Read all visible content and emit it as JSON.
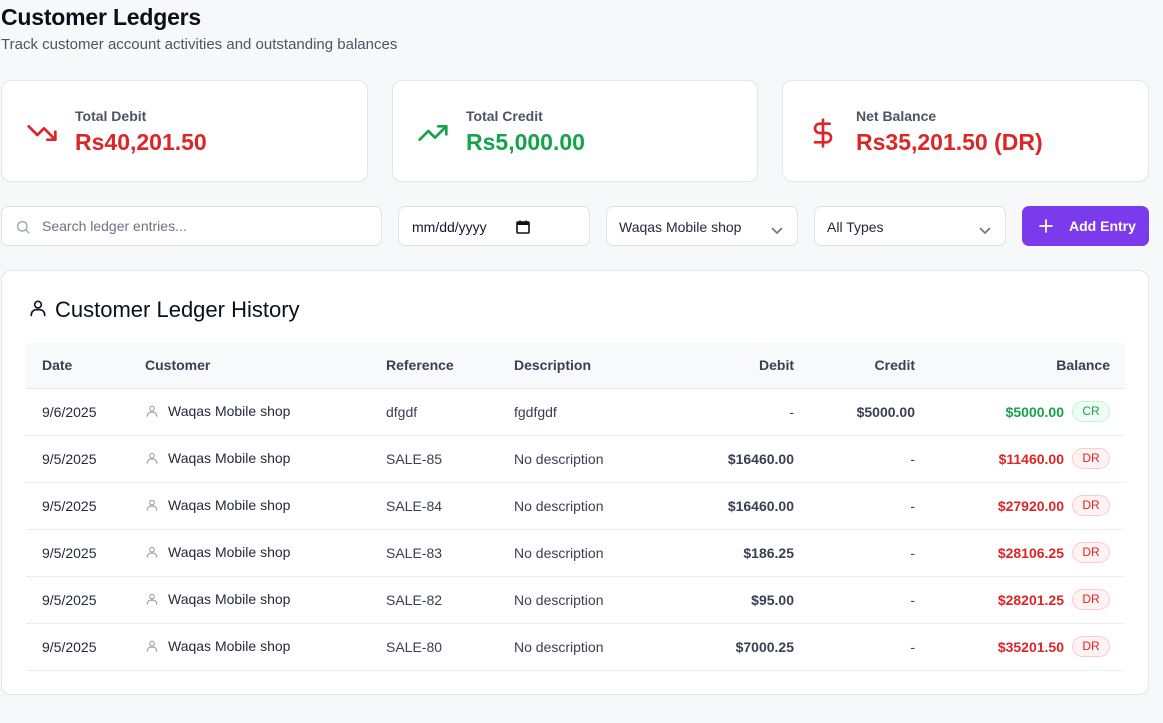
{
  "header": {
    "title": "Customer Ledgers",
    "subtitle": "Track customer account activities and outstanding balances"
  },
  "stats": {
    "debit": {
      "label": "Total Debit",
      "value": "Rs40,201.50",
      "icon": "trending-down-icon",
      "color": "#dc2626"
    },
    "credit": {
      "label": "Total Credit",
      "value": "Rs5,000.00",
      "icon": "trending-up-icon",
      "color": "#16a34a"
    },
    "net": {
      "label": "Net Balance",
      "value": "Rs35,201.50 (DR)",
      "icon": "dollar-icon",
      "color": "#dc2626"
    }
  },
  "filters": {
    "search_placeholder": "Search ledger entries...",
    "date_value": "mm/dd/yyyy",
    "customer_selected": "Waqas Mobile shop",
    "type_selected": "All Types",
    "add_label": "Add Entry"
  },
  "ledger": {
    "title": "Customer Ledger History",
    "columns": {
      "date": "Date",
      "customer": "Customer",
      "reference": "Reference",
      "description": "Description",
      "debit": "Debit",
      "credit": "Credit",
      "balance": "Balance"
    },
    "rows": [
      {
        "date": "9/6/2025",
        "customer": "Waqas Mobile shop",
        "reference": "dfgdf",
        "description": "fgdfgdf",
        "debit": "-",
        "credit": "$5000.00",
        "balance": "$5000.00",
        "badge": "CR"
      },
      {
        "date": "9/5/2025",
        "customer": "Waqas Mobile shop",
        "reference": "SALE-85",
        "description": "No description",
        "debit": "$16460.00",
        "credit": "-",
        "balance": "$11460.00",
        "badge": "DR"
      },
      {
        "date": "9/5/2025",
        "customer": "Waqas Mobile shop",
        "reference": "SALE-84",
        "description": "No description",
        "debit": "$16460.00",
        "credit": "-",
        "balance": "$27920.00",
        "badge": "DR"
      },
      {
        "date": "9/5/2025",
        "customer": "Waqas Mobile shop",
        "reference": "SALE-83",
        "description": "No description",
        "debit": "$186.25",
        "credit": "-",
        "balance": "$28106.25",
        "badge": "DR"
      },
      {
        "date": "9/5/2025",
        "customer": "Waqas Mobile shop",
        "reference": "SALE-82",
        "description": "No description",
        "debit": "$95.00",
        "credit": "-",
        "balance": "$28201.25",
        "badge": "DR"
      },
      {
        "date": "9/5/2025",
        "customer": "Waqas Mobile shop",
        "reference": "SALE-80",
        "description": "No description",
        "debit": "$7000.25",
        "credit": "-",
        "balance": "$35201.50",
        "badge": "DR"
      }
    ]
  },
  "colors": {
    "accent": "#7c3aed",
    "debit": "#dc2626",
    "credit": "#16a34a"
  }
}
